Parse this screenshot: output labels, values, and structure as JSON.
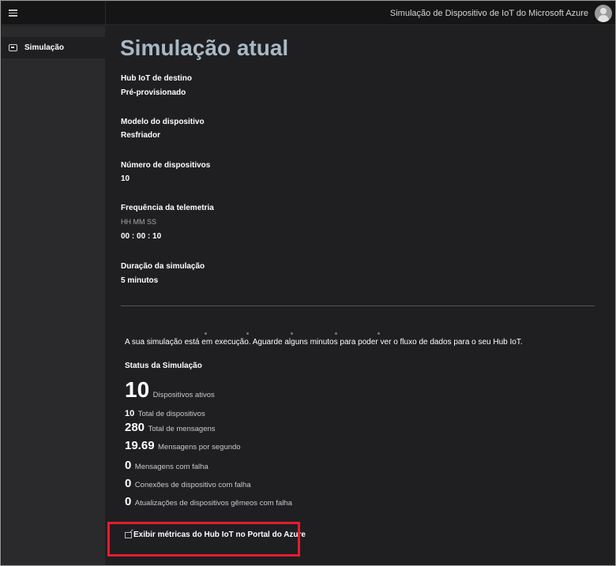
{
  "header": {
    "app_title": "Simulação de Dispositivo de IoT do Microsoft Azure",
    "menu_icon": "hamburger-menu-icon",
    "avatar_icon": "user-avatar-icon"
  },
  "sidebar": {
    "items": [
      {
        "label": "Simulação",
        "icon": "simulation-icon"
      }
    ]
  },
  "main": {
    "title": "Simulação atual",
    "fields": {
      "hub_label": "Hub IoT de destino",
      "hub_value": "Pré-provisionado",
      "model_label": "Modelo do dispositivo",
      "model_value": "Resfriador",
      "devices_label": "Número de dispositivos",
      "devices_value": "10",
      "telemetry_label": "Frequência da telemetria",
      "telemetry_format": "HH MM SS",
      "telemetry_value": "00 : 00 : 10",
      "duration_label": "Duração da simulação",
      "duration_value": "5 minutos"
    },
    "running_message": "A sua simulação está em execução. Aguarde alguns minutos para poder ver o fluxo de dados para o seu Hub IoT.",
    "status": {
      "title": "Status da Simulação",
      "active_devices": "10",
      "active_devices_label": "Dispositivos ativos",
      "total_devices": "10",
      "total_devices_label": "Total de dispositivos",
      "total_messages": "280",
      "total_messages_label": "Total de mensagens",
      "messages_per_second": "19.69",
      "messages_per_second_label": "Mensagens por segundo",
      "failed_messages": "0",
      "failed_messages_label": "Mensagens com falha",
      "failed_connections": "0",
      "failed_connections_label": "Conexões de dispositivo com falha",
      "failed_twin_updates": "0",
      "failed_twin_updates_label": "Atualizações de dispositivos gêmeos com falha"
    },
    "portal_link": {
      "label": "Exibir métricas do Hub IoT no Portal do Azure",
      "icon": "external-link-icon"
    }
  },
  "colors": {
    "background": "#1f1f21",
    "sidebar": "#2a2a2c",
    "topbar": "#151515",
    "title": "#a9b8c5",
    "highlight": "#e31d2f"
  }
}
